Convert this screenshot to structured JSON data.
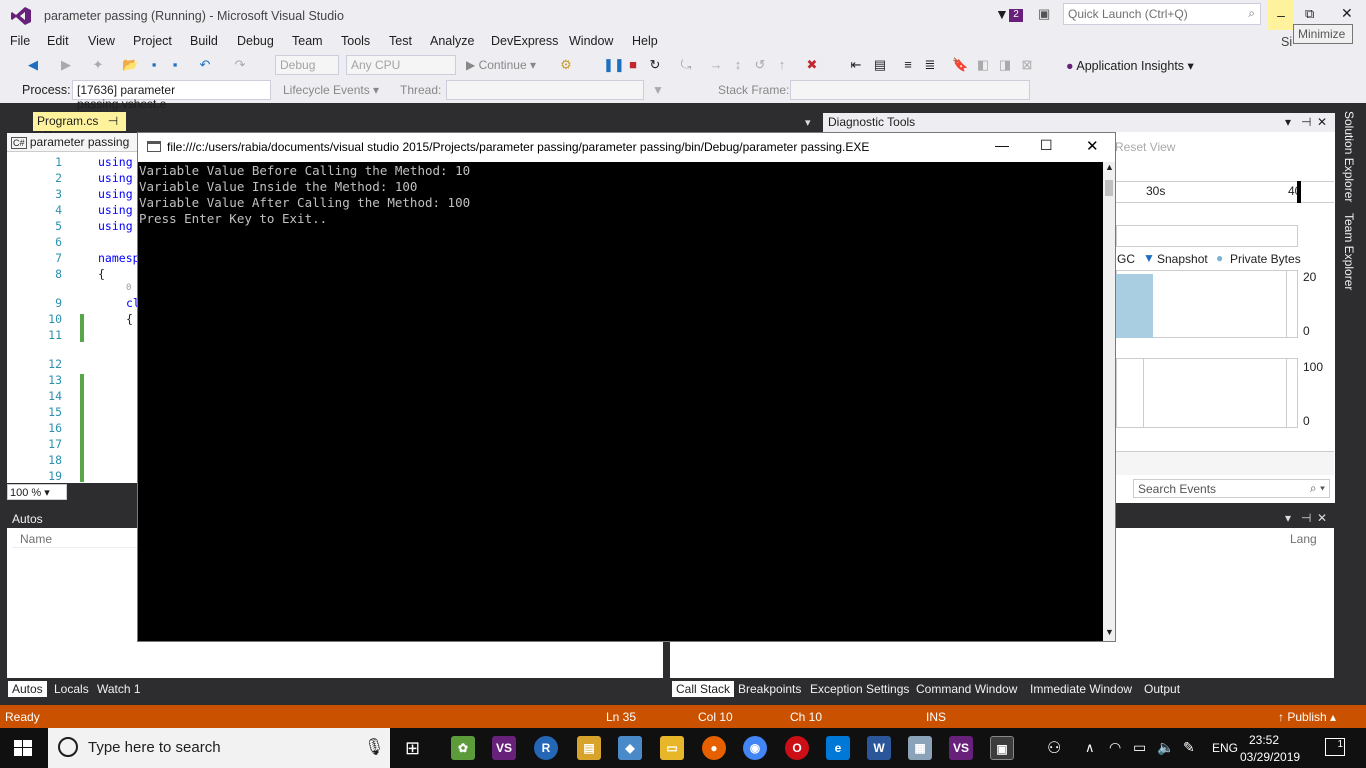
{
  "window": {
    "title": "parameter passing (Running) - Microsoft Visual Studio",
    "notifications": "2",
    "quick_launch_placeholder": "Quick Launch (Ctrl+Q)",
    "tooltip": "Minimize",
    "signin": "Si"
  },
  "menu": [
    "File",
    "Edit",
    "View",
    "Project",
    "Build",
    "Debug",
    "Team",
    "Tools",
    "Test",
    "Analyze",
    "DevExpress",
    "Window",
    "Help"
  ],
  "toolbar": {
    "config": "Debug",
    "platform": "Any CPU",
    "continue_label": "Continue",
    "insights": "Application Insights"
  },
  "debugbar": {
    "process_label": "Process:",
    "process_value": "[17636] parameter passing.vshost.e",
    "lifecycle": "Lifecycle Events",
    "thread_label": "Thread:",
    "stackframe_label": "Stack Frame:"
  },
  "editor": {
    "tab": "Program.cs",
    "scope": "parameter passing",
    "zoom": "100 %",
    "lines": [
      "1",
      "2",
      "3",
      "4",
      "5",
      "6",
      "7",
      "8",
      "9",
      "10",
      "11",
      "12",
      "13",
      "14",
      "15",
      "16",
      "17",
      "18",
      "19"
    ],
    "code": [
      "using",
      "using",
      "using",
      "using",
      "using",
      "",
      "namesp",
      "{",
      "cl",
      "{"
    ],
    "refs_hint": "0 r"
  },
  "console": {
    "title": "file:///c:/users/rabia/documents/visual studio 2015/Projects/parameter passing/parameter passing/bin/Debug/parameter passing.EXE",
    "lines": [
      "Variable Value Before Calling the Method: 10",
      "Variable Value Inside the Method: 100",
      "Variable Value After Calling the Method: 100",
      "Press Enter Key to Exit.."
    ]
  },
  "diagnostics": {
    "title": "Diagnostic Tools",
    "reset": "Reset View",
    "time_30": "30s",
    "time_40": "40",
    "gc": "GC",
    "snapshot": "Snapshot",
    "private_bytes": "Private Bytes",
    "mem_max": "20",
    "mem_min": "0",
    "cpu_max": "100",
    "cpu_min": "0",
    "search_placeholder": "Search Events"
  },
  "autos": {
    "title": "Autos",
    "col_name": "Name",
    "tabs": [
      "Autos",
      "Locals",
      "Watch 1"
    ]
  },
  "callstack": {
    "col_lang": "Lang",
    "tabs": [
      "Call Stack",
      "Breakpoints",
      "Exception Settings",
      "Command Window",
      "Immediate Window",
      "Output"
    ]
  },
  "rightstrip": [
    "Solution Explorer",
    "Team Explorer"
  ],
  "status": {
    "ready": "Ready",
    "ln": "Ln 35",
    "col": "Col 10",
    "ch": "Ch 10",
    "ins": "INS",
    "publish": "Publish"
  },
  "taskbar": {
    "search": "Type here to search",
    "lang": "ENG",
    "time": "23:52",
    "date": "03/29/2019",
    "notif": "1"
  }
}
